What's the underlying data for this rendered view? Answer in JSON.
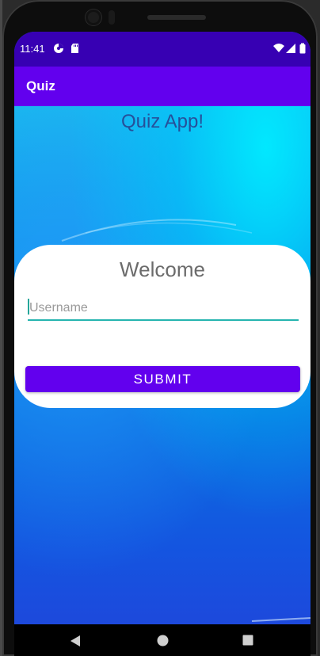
{
  "status_bar": {
    "time": "11:41",
    "icons": [
      "signal-app-icon",
      "sd-card-icon",
      "wifi-icon",
      "cell-signal-icon",
      "battery-icon"
    ]
  },
  "app_bar": {
    "title": "Quiz"
  },
  "main": {
    "heading": "Quiz App!",
    "card": {
      "welcome": "Welcome",
      "username_placeholder": "Username",
      "username_value": "",
      "submit_label": "SUBMIT"
    }
  },
  "nav_bar": {
    "buttons": [
      "back-icon",
      "home-icon",
      "recents-icon"
    ]
  },
  "colors": {
    "status_bar": "#3700b3",
    "app_bar": "#6200ee",
    "accent": "#26b5b0",
    "button": "#6200ee"
  }
}
